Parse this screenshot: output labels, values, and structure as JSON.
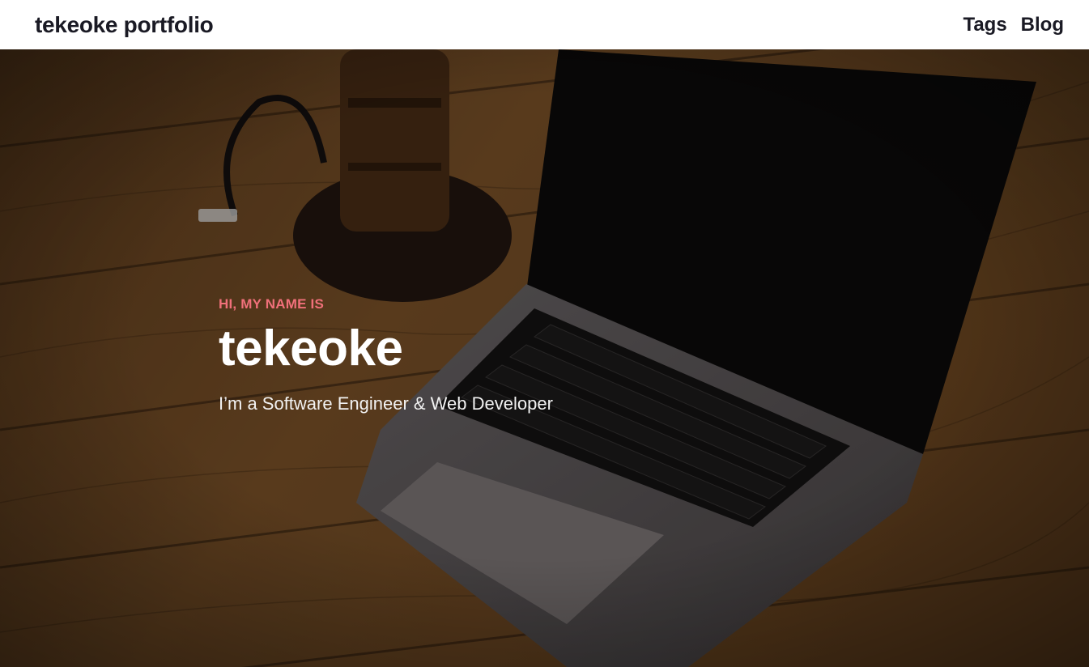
{
  "header": {
    "site_title": "tekeoke portfolio",
    "nav": [
      {
        "label": "Tags"
      },
      {
        "label": "Blog"
      }
    ]
  },
  "hero": {
    "eyebrow": "HI, MY NAME IS",
    "name": "tekeoke",
    "tagline": "I’m a Software Engineer & Web Developer",
    "background_image": "laptop on wooden desk"
  },
  "colors": {
    "accent": "#f0707a",
    "header_text": "#1a1a24",
    "hero_text": "#ffffff"
  }
}
